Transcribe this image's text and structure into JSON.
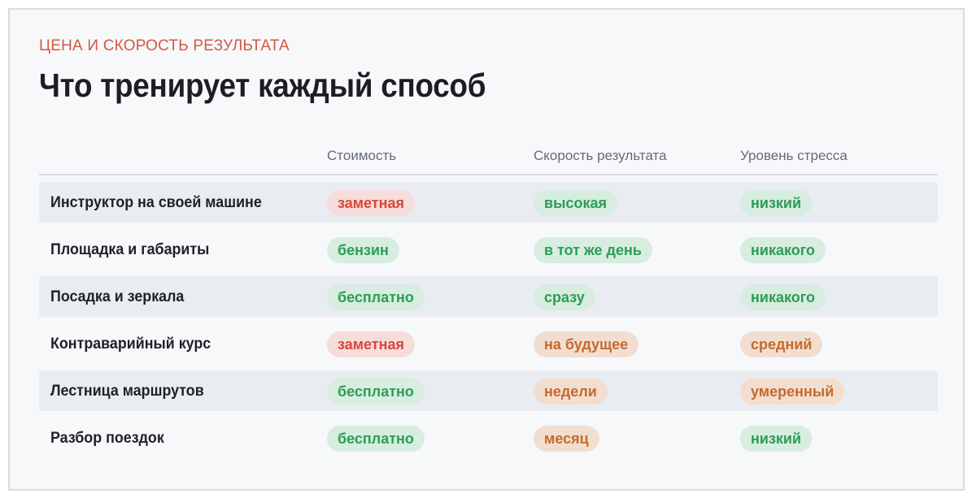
{
  "eyebrow": "ЦЕНА И СКОРОСТЬ РЕЗУЛЬТАТА",
  "title": "Что тренирует каждый способ",
  "columns": [
    "Стоимость",
    "Скорость результата",
    "Уровень стресса"
  ],
  "colors": {
    "accent": "#d25a3f",
    "green_text": "#2d9d55",
    "green_bg": "#d6ede0",
    "red_text": "#d6483a",
    "red_bg": "#f6dcda",
    "orange_text": "#c66a2c",
    "orange_bg": "#f2ded0"
  },
  "rows": [
    {
      "label": "Инструктор на своей машине",
      "cost": {
        "text": "заметная",
        "tone": "red"
      },
      "speed": {
        "text": "высокая",
        "tone": "green"
      },
      "stress": {
        "text": "низкий",
        "tone": "green"
      }
    },
    {
      "label": "Площадка и габариты",
      "cost": {
        "text": "бензин",
        "tone": "green"
      },
      "speed": {
        "text": "в тот же день",
        "tone": "green"
      },
      "stress": {
        "text": "никакого",
        "tone": "green"
      }
    },
    {
      "label": "Посадка и зеркала",
      "cost": {
        "text": "бесплатно",
        "tone": "green"
      },
      "speed": {
        "text": "сразу",
        "tone": "green"
      },
      "stress": {
        "text": "никакого",
        "tone": "green"
      }
    },
    {
      "label": "Контраварийный курс",
      "cost": {
        "text": "заметная",
        "tone": "red"
      },
      "speed": {
        "text": "на будущее",
        "tone": "orange"
      },
      "stress": {
        "text": "средний",
        "tone": "orange"
      }
    },
    {
      "label": "Лестница маршрутов",
      "cost": {
        "text": "бесплатно",
        "tone": "green"
      },
      "speed": {
        "text": "недели",
        "tone": "orange"
      },
      "stress": {
        "text": "умеренный",
        "tone": "orange"
      }
    },
    {
      "label": "Разбор поездок",
      "cost": {
        "text": "бесплатно",
        "tone": "green"
      },
      "speed": {
        "text": "месяц",
        "tone": "orange"
      },
      "stress": {
        "text": "низкий",
        "tone": "green"
      }
    }
  ]
}
